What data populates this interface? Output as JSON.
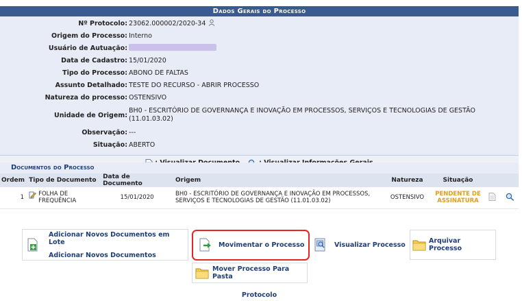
{
  "panel": {
    "title": "Dados Gerais do Processo"
  },
  "fields": {
    "protocolo": {
      "label": "Nº Protocolo:",
      "value": "23062.000002/2020-34"
    },
    "origem_processo": {
      "label": "Origem do Processo:",
      "value": "Interno"
    },
    "usuario": {
      "label": "Usuário de Autuação:"
    },
    "data_cadastro": {
      "label": "Data de Cadastro:",
      "value": "15/01/2020"
    },
    "tipo": {
      "label": "Tipo do Processo:",
      "value": "ABONO DE FALTAS"
    },
    "assunto": {
      "label": "Assunto Detalhado:",
      "value": "TESTE DO RECURSO - ABRIR PROCESSO"
    },
    "natureza": {
      "label": "Natureza do processo:",
      "value": "OSTENSIVO"
    },
    "unidade": {
      "label": "Unidade de Origem:",
      "value": "BH0 - ESCRITÓRIO DE GOVERNANÇA E INOVAÇÃO EM PROCESSOS, SERVIÇOS E TECNOLOGIAS DE GESTÃO (11.01.03.02)"
    },
    "observacao": {
      "label": "Observação:",
      "value": "---"
    },
    "situacao": {
      "label": "Situação:",
      "value": "ABERTO"
    }
  },
  "links": {
    "visualizar_documento": ": Visualizar Documento",
    "visualizar_info": ": Visualizar Informações Gerais"
  },
  "documents": {
    "title": "Documentos do Processo",
    "headers": [
      "Ordem",
      "Tipo de Documento",
      "Data de Documento",
      "Origem",
      "Natureza",
      "Situação"
    ],
    "row": {
      "ordem": "1",
      "tipo": "FOLHA DE FREQUÊNCIA",
      "data": "15/01/2020",
      "origem": "BH0 - ESCRITÓRIO DE GOVERNANÇA E INOVAÇÃO EM PROCESSOS, SERVIÇOS E TECNOLOGIAS DE GESTÃO (11.01.03.02)",
      "natureza": "OSTENSIVO",
      "situacao": "PENDENTE DE ASSINATURA"
    }
  },
  "actions": {
    "add_lote": "Adicionar Novos Documentos em Lote",
    "add_docs": "Adicionar Novos Documentos",
    "movimentar": "Movimentar o Processo",
    "visualizar": "Visualizar Processo",
    "arquivar": "Arquivar Processo",
    "mover_pasta": "Mover Processo Para Pasta",
    "protocolo": "Protocolo"
  },
  "colors": {
    "header_bg": "#3b5a8f",
    "panel_bg": "#e8ecf6",
    "link": "#1f3e78",
    "pending": "#e89a1a",
    "highlight": "#e52424"
  }
}
